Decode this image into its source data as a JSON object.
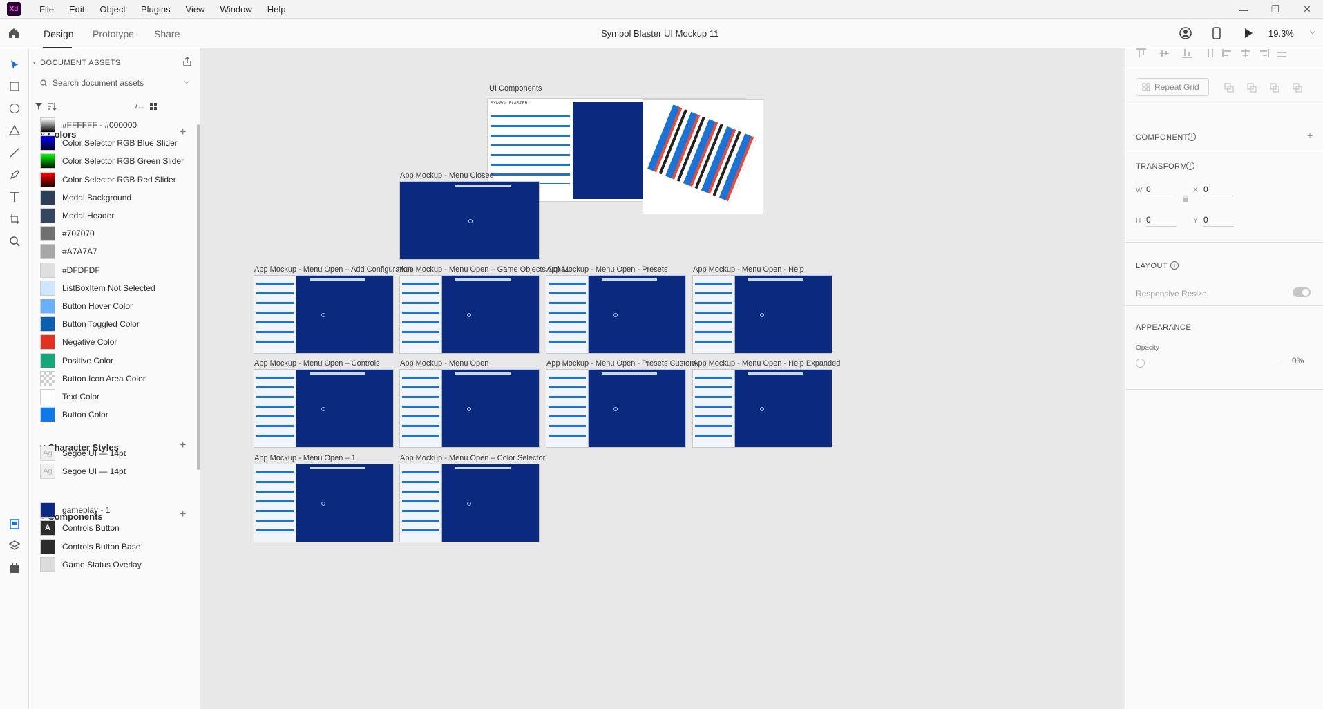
{
  "menubar": {
    "logo": "Xd",
    "items": [
      "File",
      "Edit",
      "Object",
      "Plugins",
      "View",
      "Window",
      "Help"
    ]
  },
  "topbar": {
    "tabs": [
      "Design",
      "Prototype",
      "Share"
    ],
    "active_tab": "Design",
    "document_title": "Symbol Blaster UI Mockup 11",
    "zoom": "19.3%"
  },
  "assets": {
    "header": "DOCUMENT ASSETS",
    "search_placeholder": "Search document assets",
    "filter_text": "/...",
    "colors_title": "Colors",
    "colors": [
      {
        "label": "#FFFFFF - #000000",
        "fill": "linear-gradient(#ffffff,#000000)"
      },
      {
        "label": "Color Selector RGB Blue Slider",
        "fill": "linear-gradient(#0000ff,#000022)"
      },
      {
        "label": "Color Selector RGB Green Slider",
        "fill": "linear-gradient(#00ff00,#001100)"
      },
      {
        "label": "Color Selector RGB Red Slider",
        "fill": "linear-gradient(#ff0000,#220000)"
      },
      {
        "label": "Modal Background",
        "fill": "#2b3f56"
      },
      {
        "label": "Modal Header",
        "fill": "#34475e"
      },
      {
        "label": "#707070",
        "fill": "#707070"
      },
      {
        "label": "#A7A7A7",
        "fill": "#a7a7a7"
      },
      {
        "label": "#DFDFDF",
        "fill": "#dfdfdf"
      },
      {
        "label": "ListBoxItem Not Selected",
        "fill": "#cfe6ff"
      },
      {
        "label": "Button Hover Color",
        "fill": "#69b0ff"
      },
      {
        "label": "Button Toggled Color",
        "fill": "#0a5fb0"
      },
      {
        "label": "Negative Color",
        "fill": "#e0321f"
      },
      {
        "label": "Positive Color",
        "fill": "#13a87a"
      },
      {
        "label": "Button Icon Area Color",
        "fill": "repeating-conic-gradient(#cccccc 0% 25%, #ffffff 0% 50%) 0 0/8px 8px"
      },
      {
        "label": "Text Color",
        "fill": "#ffffff"
      },
      {
        "label": "Button Color",
        "fill": "#0e79e8"
      }
    ],
    "char_styles_title": "Character Styles",
    "char_styles": [
      {
        "label": "Segoe UI — 14pt",
        "glyph": "Ag"
      },
      {
        "label": "Segoe UI — 14pt",
        "glyph": "Ag"
      }
    ],
    "components_title": "Components",
    "components": [
      {
        "label": "gameplay - 1",
        "fill": "#0a2a80",
        "glyph": ""
      },
      {
        "label": "Controls Button",
        "fill": "#2c2c2c",
        "glyph": "A"
      },
      {
        "label": "Controls Button Base",
        "fill": "#2c2c2c",
        "glyph": ""
      },
      {
        "label": "Game Status Overlay",
        "fill": "#dcdcdc",
        "glyph": ""
      }
    ]
  },
  "canvas": {
    "ui_components_label": "UI Components",
    "ui_components_brand": "SYMBOL BLASTER",
    "artboards": [
      {
        "label": "App Mockup - Menu Closed",
        "side": false
      },
      {
        "label": "App Mockup - Menu Open – Add Configuration",
        "side": true
      },
      {
        "label": "App Mockup - Menu Open – Game Objects Colla...",
        "side": true
      },
      {
        "label": "App Mockup - Menu Open - Presets",
        "side": true
      },
      {
        "label": "App Mockup - Menu Open - Help",
        "side": true
      },
      {
        "label": "App Mockup - Menu Open – Controls",
        "side": true
      },
      {
        "label": "App Mockup - Menu Open",
        "side": true
      },
      {
        "label": "App Mockup - Menu Open - Presets Custom",
        "side": true
      },
      {
        "label": "App Mockup - Menu Open - Help Expanded",
        "side": true
      },
      {
        "label": "App Mockup - Menu Open – 1",
        "side": true
      },
      {
        "label": "App Mockup - Menu Open – Color Selector",
        "side": true
      }
    ]
  },
  "props": {
    "repeat_grid": "Repeat Grid",
    "component": "COMPONENT",
    "transform": "TRANSFORM",
    "w_label": "W",
    "w_value": "0",
    "x_label": "X",
    "x_value": "0",
    "h_label": "H",
    "h_value": "0",
    "y_label": "Y",
    "y_value": "0",
    "layout": "LAYOUT",
    "responsive_resize": "Responsive Resize",
    "responsive_resize_on": false,
    "appearance": "APPEARANCE",
    "opacity_label": "Opacity",
    "opacity_value": "0%"
  }
}
